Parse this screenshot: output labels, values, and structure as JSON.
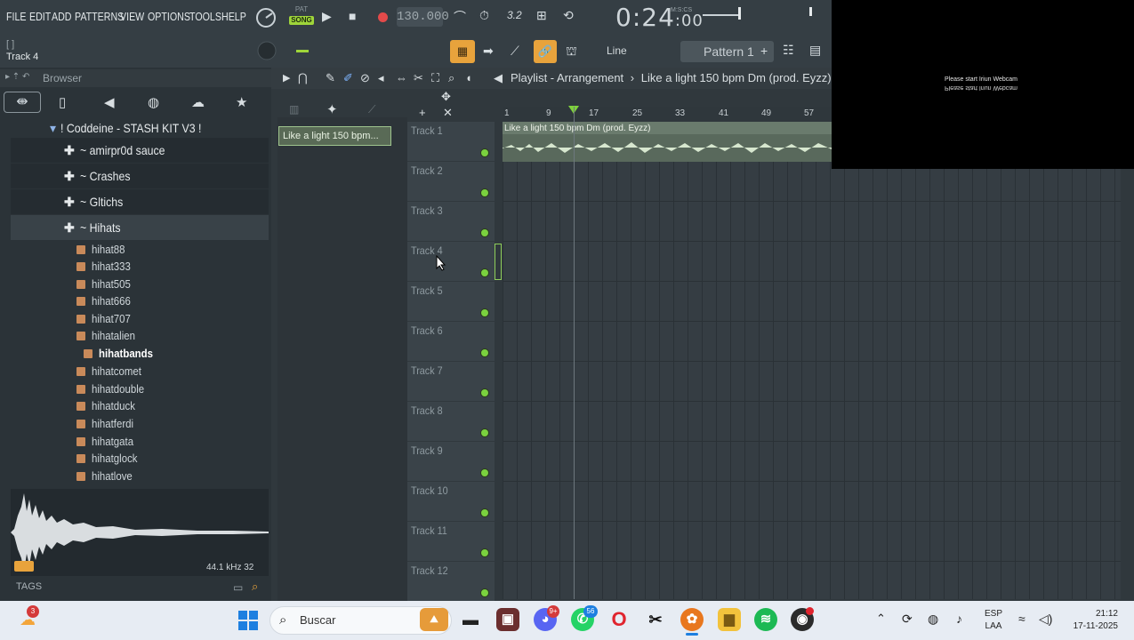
{
  "menubar": {
    "items": [
      "FILE",
      "EDIT",
      "ADD",
      "PATTERNS",
      "VIEW",
      "OPTIONS",
      "TOOLS",
      "HELP"
    ],
    "pat_label": "PAT",
    "song_label": "SONG",
    "tempo": "130.000",
    "time": "0:24",
    "time_sub": ":00",
    "time_unit": "M:S:CS",
    "snap_value": "3.2"
  },
  "hint": {
    "bracket_text": "[ ]",
    "current_track": "Track 4"
  },
  "toolbar2": {
    "snap_mode": "Line",
    "pattern": "Pattern 1",
    "add_label": "+"
  },
  "browser": {
    "title": "Browser",
    "tree": [
      {
        "label": "! Coddeine - STASH KIT V3 !"
      },
      {
        "label": "~ amirpr0d sauce"
      },
      {
        "label": "~ Crashes"
      },
      {
        "label": "~ Gltichs"
      },
      {
        "label": "~ Hihats"
      }
    ],
    "files": [
      "hihat88",
      "hihat333",
      "hihat505",
      "hihat666",
      "hihat707",
      "hihatalien",
      "hihatbands",
      "hihatcomet",
      "hihatdouble",
      "hihatduck",
      "hihatferdi",
      "hihatgata",
      "hihatglock",
      "hihatlove"
    ],
    "selected_file": "hihatbands",
    "sample_rate": "44.1 kHz 32",
    "tags_label": "TAGS"
  },
  "channel": {
    "pattern_clip": "Like a light 150 bpm..."
  },
  "playlist": {
    "title": "Playlist - Arrangement",
    "project": "Like a light 150 bpm Dm (prod. Eyzz)",
    "clip_label": "Like a light 150 bpm Dm (prod. Eyzz)",
    "ruler": [
      "1",
      "9",
      "17",
      "25",
      "33",
      "41",
      "49",
      "57"
    ],
    "tracks": [
      "Track 1",
      "Track 2",
      "Track 3",
      "Track 4",
      "Track 5",
      "Track 6",
      "Track 7",
      "Track 8",
      "Track 9",
      "Track 10",
      "Track 11",
      "Track 12"
    ]
  },
  "webcam": {
    "message": "Please start Iriun Webcam"
  },
  "taskbar": {
    "search_placeholder": "Buscar",
    "weather_badge": "3",
    "discord_badge": "9+",
    "whatsapp_badge": "56",
    "lang_top": "ESP",
    "lang_bottom": "LAA",
    "time": "21:12",
    "date": "17-11-2025"
  }
}
